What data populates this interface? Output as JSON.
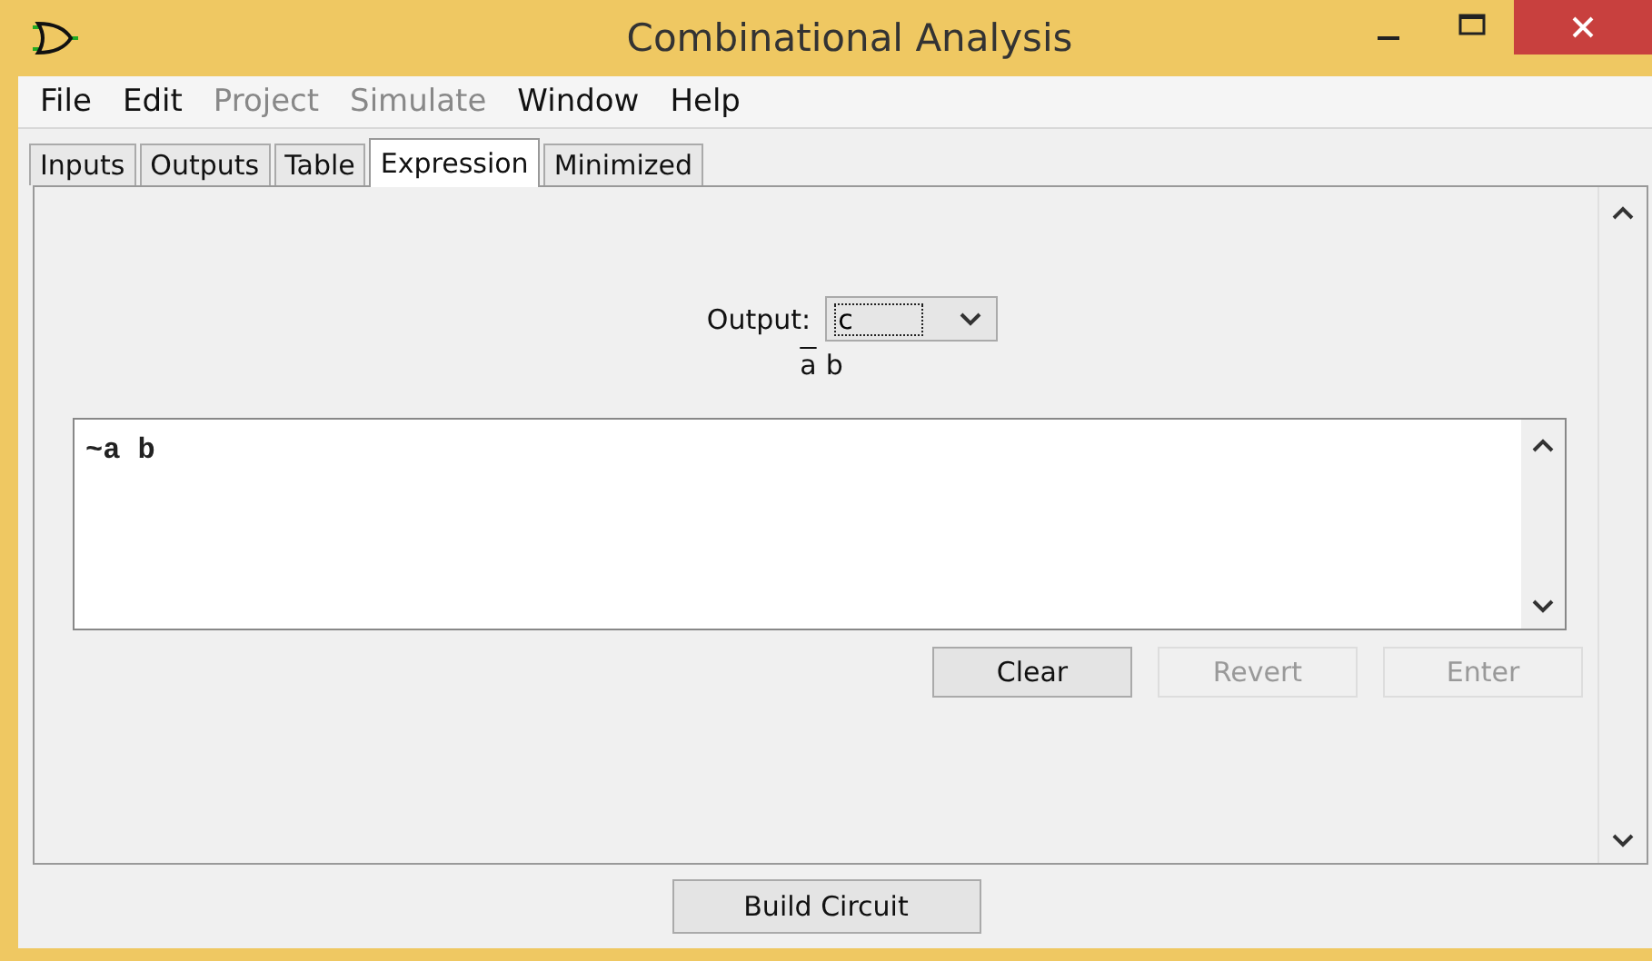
{
  "window": {
    "title": "Combinational Analysis"
  },
  "menu": [
    {
      "label": "File",
      "disabled": false
    },
    {
      "label": "Edit",
      "disabled": false
    },
    {
      "label": "Project",
      "disabled": true
    },
    {
      "label": "Simulate",
      "disabled": true
    },
    {
      "label": "Window",
      "disabled": false
    },
    {
      "label": "Help",
      "disabled": false
    }
  ],
  "tabs": [
    {
      "label": "Inputs",
      "selected": false
    },
    {
      "label": "Outputs",
      "selected": false
    },
    {
      "label": "Table",
      "selected": false
    },
    {
      "label": "Expression",
      "selected": true
    },
    {
      "label": "Minimized",
      "selected": false
    }
  ],
  "output": {
    "label": "Output:",
    "value": "c"
  },
  "expression_display": [
    {
      "text": "a",
      "negated": true
    },
    {
      "text": "b",
      "negated": false
    }
  ],
  "expression_editor": {
    "value": "~a b"
  },
  "buttons": [
    {
      "label": "Clear",
      "disabled": false
    },
    {
      "label": "Revert",
      "disabled": true
    },
    {
      "label": "Enter",
      "disabled": true
    }
  ],
  "build_button": {
    "label": "Build Circuit"
  }
}
